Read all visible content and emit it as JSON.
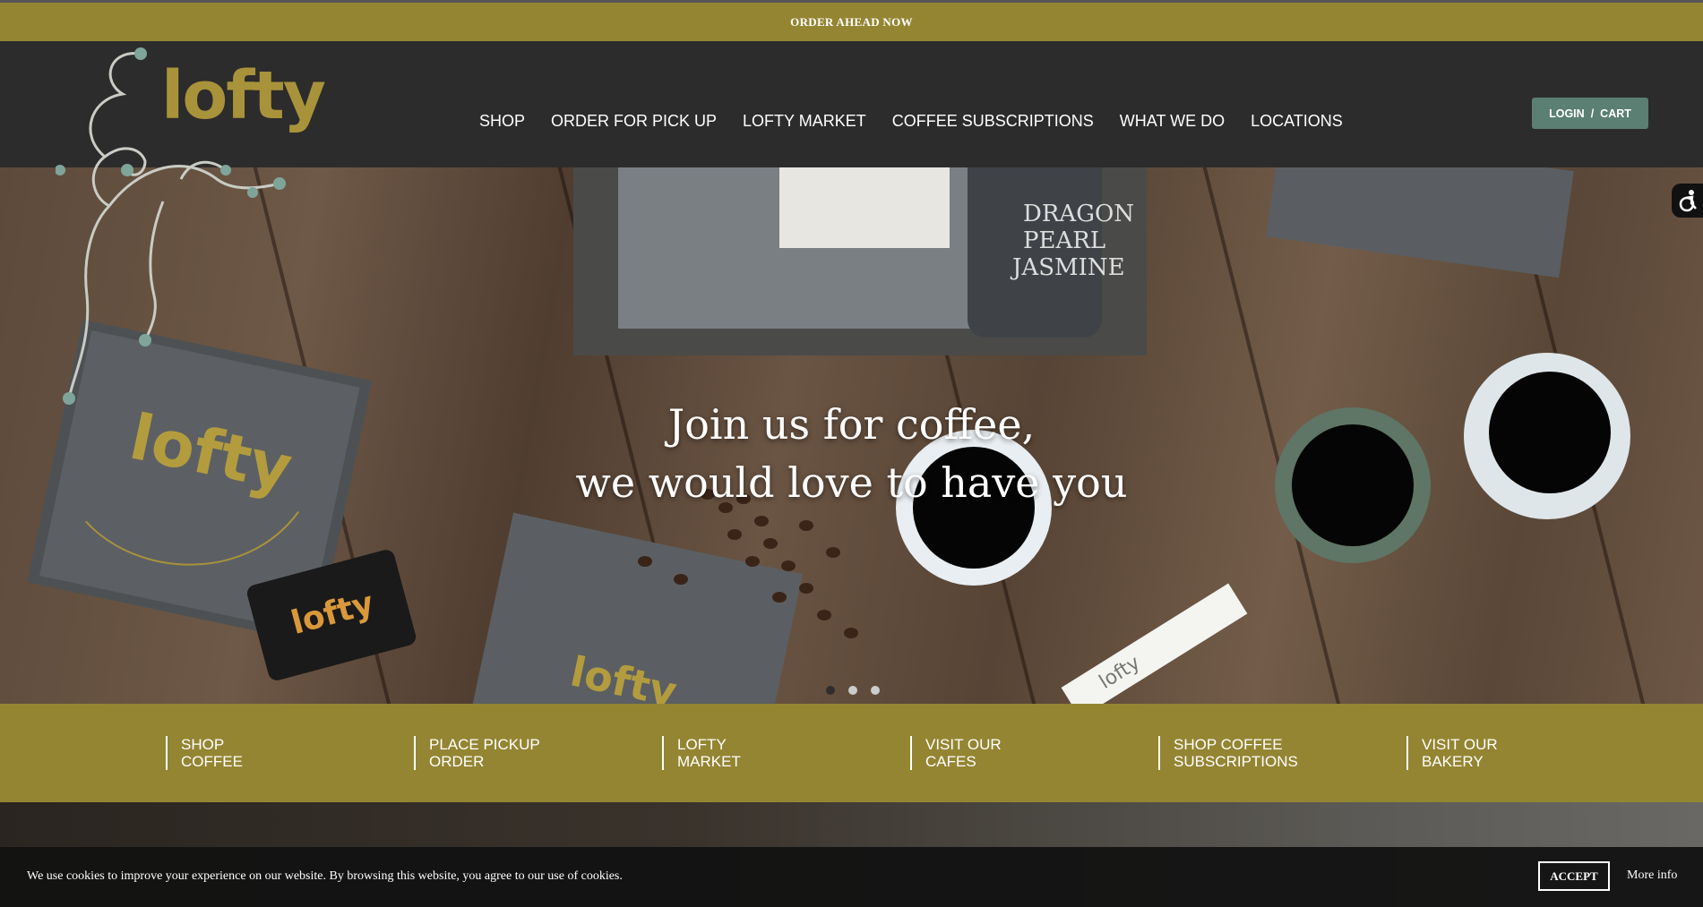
{
  "announcement": {
    "label": "ORDER AHEAD NOW"
  },
  "brand": {
    "logo_text": "lofty",
    "accent": "#948533",
    "dark": "#2c2c2c",
    "button": "#5b7f73"
  },
  "nav": {
    "items": [
      {
        "label": "SHOP"
      },
      {
        "label": "ORDER FOR PICK UP"
      },
      {
        "label": "LOFTY MARKET"
      },
      {
        "label": "COFFEE SUBSCRIPTIONS"
      },
      {
        "label": "WHAT WE DO"
      },
      {
        "label": "LOCATIONS"
      }
    ]
  },
  "account": {
    "login": "LOGIN",
    "separator": "/",
    "cart": "CART"
  },
  "hero": {
    "line1": "Join us for coffee,",
    "line2": "we would love to have you",
    "slides": 3,
    "active_slide": 1
  },
  "quick_links": [
    {
      "line1": "SHOP",
      "line2": "COFFEE"
    },
    {
      "line1": "PLACE PICKUP",
      "line2": "ORDER"
    },
    {
      "line1": "LOFTY",
      "line2": "MARKET"
    },
    {
      "line1": "VISIT OUR",
      "line2": "CAFES"
    },
    {
      "line1": "SHOP COFFEE",
      "line2": "SUBSCRIPTIONS"
    },
    {
      "line1": "VISIT OUR",
      "line2": "BAKERY"
    }
  ],
  "cookie": {
    "message": "We use cookies to improve your experience on our website. By browsing this website, you agree to our use of cookies.",
    "accept": "ACCEPT",
    "more_info": "More info"
  }
}
